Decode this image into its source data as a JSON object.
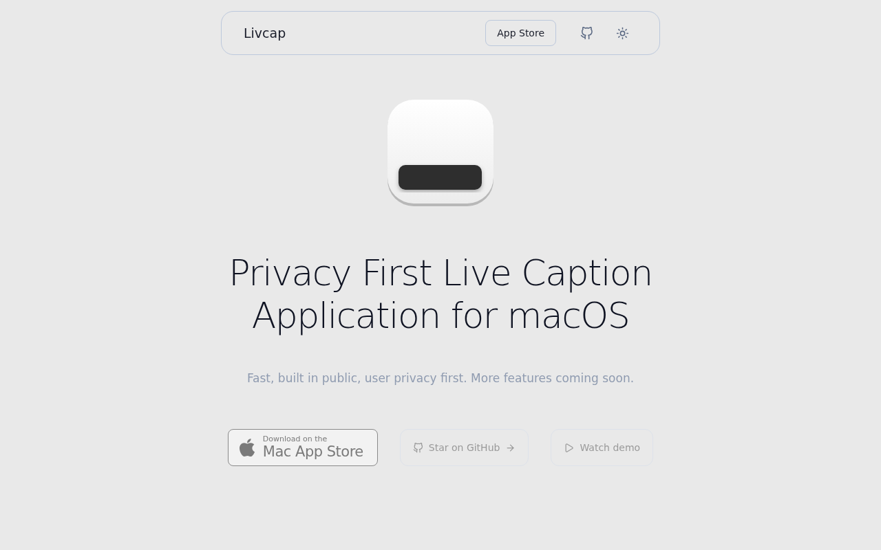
{
  "nav": {
    "brand": "Livcap",
    "store_button": "App Store"
  },
  "hero": {
    "title_lines": [
      "Privacy First Live Caption",
      "Application for macOS"
    ],
    "subtitle": "Fast, built in public, user privacy first. More features coming soon."
  },
  "badge": {
    "small": "Download on the",
    "large": "Mac App Store"
  },
  "actions": [
    {
      "kind": "github",
      "label": "Star on GitHub"
    },
    {
      "kind": "demo",
      "label": "Watch demo"
    }
  ]
}
